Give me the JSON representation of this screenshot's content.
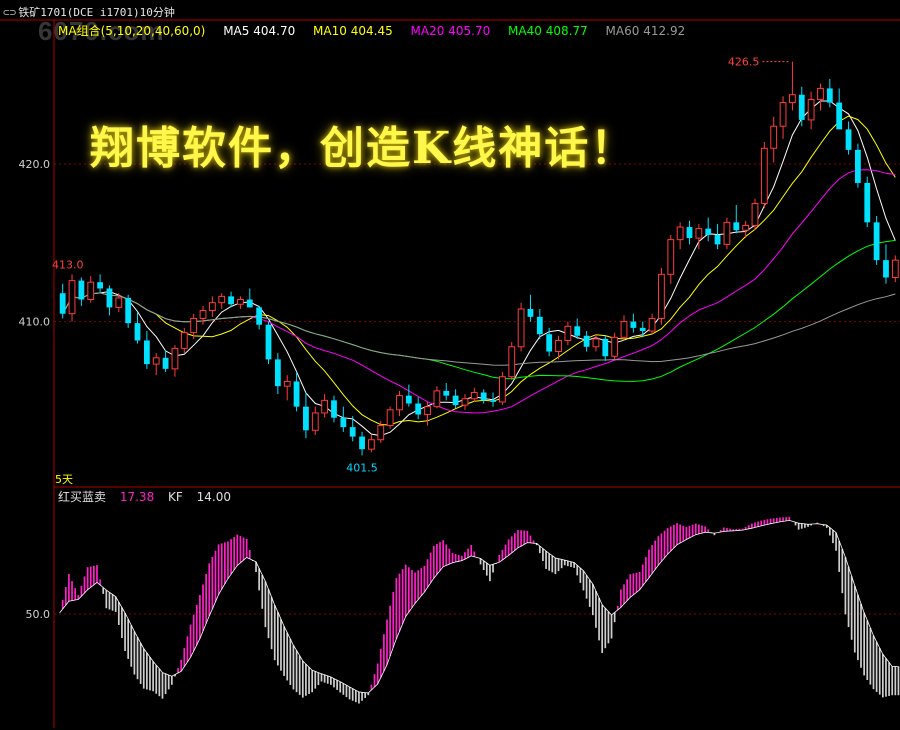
{
  "header": {
    "title": "铁矿1701(DCE i1701)10分钟",
    "lock_icon": "lock-icon"
  },
  "watermark": "6070.com",
  "slogan": "翔博软件，创造K线神话！",
  "ma_legend": {
    "group_label": "MA组合(5,10,20,40,60,0)",
    "items": [
      {
        "label": "MA5",
        "value": "404.70",
        "color": "#ffffff"
      },
      {
        "label": "MA10",
        "value": "404.45",
        "color": "#ffff00"
      },
      {
        "label": "MA20",
        "value": "405.70",
        "color": "#ff00ff"
      },
      {
        "label": "MA40",
        "value": "408.77",
        "color": "#00ff00"
      },
      {
        "label": "MA60",
        "value": "412.92",
        "color": "#999999"
      }
    ],
    "group_color": "#ffff00"
  },
  "price_axis": {
    "ticks": [
      {
        "value": 420,
        "label": "420.0"
      },
      {
        "value": 410,
        "label": "410.0"
      }
    ]
  },
  "annotations": {
    "high_label": "426.5",
    "low_label": "401.5",
    "left_label": "413.0",
    "period_label": "5天"
  },
  "indicator": {
    "name": "红买蓝卖",
    "value": "17.38",
    "kf_label": "KF",
    "kf_value": "14.00",
    "tick_label": "50.0",
    "tick_value": 50
  },
  "colors": {
    "up": "#ff3b3b",
    "down": "#00e0ff",
    "grid": "#8a0000",
    "ind_pos": "#ff20c8",
    "ind_neg": "#cfcfcf",
    "ind_blue": "#1a1aff",
    "ind_red": "#ff2020"
  },
  "chart_data": {
    "type": "candlestick",
    "y_range": [
      399.5,
      428
    ],
    "candles": [
      [
        411.8,
        412.4,
        410.2,
        410.5
      ],
      [
        410.5,
        413.0,
        410.0,
        412.6
      ],
      [
        412.6,
        412.8,
        411.0,
        411.4
      ],
      [
        411.4,
        412.9,
        411.2,
        412.5
      ],
      [
        412.5,
        413.0,
        411.8,
        412.1
      ],
      [
        412.1,
        412.3,
        410.4,
        410.9
      ],
      [
        410.9,
        411.8,
        410.6,
        411.5
      ],
      [
        411.5,
        411.7,
        409.6,
        409.9
      ],
      [
        409.9,
        410.6,
        408.6,
        408.8
      ],
      [
        408.8,
        409.4,
        407.0,
        407.3
      ],
      [
        407.3,
        408.0,
        406.6,
        407.7
      ],
      [
        407.7,
        408.2,
        406.8,
        407.0
      ],
      [
        407.0,
        408.5,
        406.5,
        408.3
      ],
      [
        408.3,
        409.6,
        408.0,
        409.3
      ],
      [
        409.3,
        410.5,
        408.9,
        410.2
      ],
      [
        410.2,
        411.0,
        409.8,
        410.7
      ],
      [
        410.7,
        411.6,
        410.3,
        411.2
      ],
      [
        411.2,
        411.8,
        410.8,
        411.6
      ],
      [
        411.6,
        411.9,
        410.9,
        411.1
      ],
      [
        411.1,
        411.6,
        410.8,
        411.4
      ],
      [
        411.4,
        412.1,
        410.9,
        410.9
      ],
      [
        410.9,
        411.0,
        409.5,
        409.8
      ],
      [
        409.8,
        410.0,
        407.3,
        407.6
      ],
      [
        407.6,
        408.0,
        405.4,
        405.9
      ],
      [
        405.9,
        406.6,
        405.0,
        406.2
      ],
      [
        406.2,
        406.8,
        404.3,
        404.6
      ],
      [
        404.6,
        405.5,
        402.6,
        403.1
      ],
      [
        403.1,
        404.6,
        402.8,
        404.2
      ],
      [
        404.2,
        405.4,
        403.9,
        405.0
      ],
      [
        405.0,
        405.3,
        403.6,
        403.9
      ],
      [
        403.9,
        404.6,
        403.0,
        403.3
      ],
      [
        403.3,
        404.0,
        402.4,
        402.7
      ],
      [
        402.7,
        403.0,
        401.5,
        401.9
      ],
      [
        401.9,
        402.8,
        401.7,
        402.5
      ],
      [
        402.5,
        403.7,
        402.3,
        403.4
      ],
      [
        403.4,
        404.6,
        403.2,
        404.4
      ],
      [
        404.4,
        405.6,
        404.0,
        405.3
      ],
      [
        405.3,
        406.0,
        404.6,
        404.8
      ],
      [
        404.8,
        405.2,
        403.8,
        404.1
      ],
      [
        404.1,
        404.9,
        403.4,
        404.6
      ],
      [
        404.6,
        405.9,
        404.5,
        405.6
      ],
      [
        405.6,
        406.1,
        405.0,
        405.3
      ],
      [
        405.3,
        405.7,
        404.5,
        404.7
      ],
      [
        404.7,
        405.4,
        404.4,
        405.1
      ],
      [
        405.1,
        405.8,
        404.9,
        405.5
      ],
      [
        405.5,
        405.7,
        404.8,
        405.0
      ],
      [
        405.0,
        405.5,
        404.6,
        404.9
      ],
      [
        404.9,
        406.8,
        404.7,
        406.5
      ],
      [
        406.5,
        408.7,
        406.3,
        408.4
      ],
      [
        408.4,
        411.2,
        408.1,
        410.8
      ],
      [
        410.8,
        411.7,
        410.0,
        410.3
      ],
      [
        410.3,
        410.8,
        408.9,
        409.2
      ],
      [
        409.2,
        409.6,
        407.8,
        408.1
      ],
      [
        408.1,
        409.1,
        407.6,
        408.8
      ],
      [
        408.8,
        410.0,
        408.5,
        409.7
      ],
      [
        409.7,
        410.2,
        408.9,
        409.1
      ],
      [
        409.1,
        409.4,
        408.1,
        408.4
      ],
      [
        408.4,
        409.2,
        408.1,
        408.9
      ],
      [
        408.9,
        409.1,
        407.5,
        407.8
      ],
      [
        407.8,
        409.3,
        407.6,
        409.0
      ],
      [
        409.0,
        410.4,
        408.8,
        410.0
      ],
      [
        410.0,
        410.5,
        409.3,
        409.6
      ],
      [
        409.6,
        410.0,
        409.0,
        409.4
      ],
      [
        409.4,
        410.5,
        409.2,
        410.2
      ],
      [
        410.2,
        413.4,
        409.8,
        413.0
      ],
      [
        413.0,
        415.5,
        412.4,
        415.2
      ],
      [
        415.2,
        416.3,
        414.6,
        416.0
      ],
      [
        416.0,
        416.4,
        414.9,
        415.3
      ],
      [
        415.3,
        416.2,
        414.6,
        415.9
      ],
      [
        415.9,
        416.6,
        415.1,
        415.5
      ],
      [
        415.5,
        416.2,
        414.6,
        414.9
      ],
      [
        414.9,
        416.6,
        414.6,
        416.3
      ],
      [
        416.3,
        417.4,
        415.6,
        415.8
      ],
      [
        415.8,
        416.4,
        415.3,
        416.1
      ],
      [
        416.1,
        417.8,
        415.8,
        417.5
      ],
      [
        417.5,
        421.4,
        417.2,
        421.0
      ],
      [
        421.0,
        423.0,
        420.1,
        422.4
      ],
      [
        422.4,
        424.3,
        421.6,
        423.9
      ],
      [
        423.9,
        426.5,
        423.4,
        424.4
      ],
      [
        424.4,
        424.9,
        422.4,
        422.8
      ],
      [
        422.8,
        424.6,
        422.2,
        424.1
      ],
      [
        424.1,
        425.1,
        423.4,
        424.8
      ],
      [
        424.8,
        425.4,
        423.6,
        423.9
      ],
      [
        423.9,
        424.8,
        422.9,
        422.2
      ],
      [
        422.2,
        422.7,
        420.6,
        420.9
      ],
      [
        420.9,
        421.3,
        418.5,
        418.8
      ],
      [
        418.8,
        419.2,
        416.0,
        416.3
      ],
      [
        416.3,
        416.7,
        413.6,
        413.9
      ],
      [
        413.9,
        414.9,
        412.4,
        412.8
      ],
      [
        412.8,
        414.2,
        412.5,
        413.9
      ]
    ]
  }
}
